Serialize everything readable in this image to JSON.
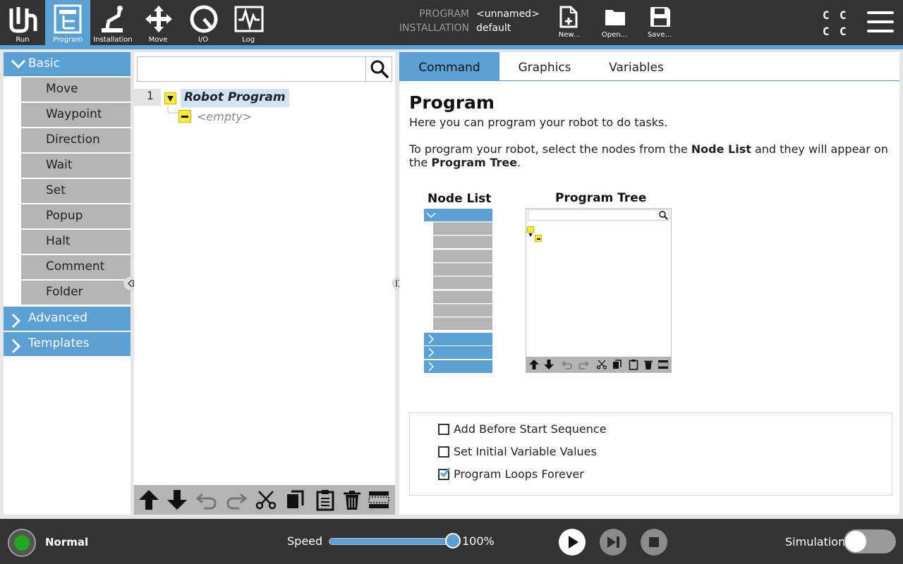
{
  "topbar": {
    "nav": [
      {
        "id": "run",
        "label": "Run",
        "icon": "ur-logo-icon"
      },
      {
        "id": "program",
        "label": "Program",
        "icon": "program-tree-icon",
        "active": true
      },
      {
        "id": "installation",
        "label": "Installation",
        "icon": "robot-arm-icon"
      },
      {
        "id": "move",
        "label": "Move",
        "icon": "move-arrows-icon"
      },
      {
        "id": "io",
        "label": "I/O",
        "icon": "io-gauge-icon"
      },
      {
        "id": "log",
        "label": "Log",
        "icon": "log-chart-icon"
      }
    ],
    "program_key": "PROGRAM",
    "program_value": "<unnamed>",
    "installation_key": "INSTALLATION",
    "installation_value": "default",
    "file_buttons": [
      {
        "label": "New...",
        "icon": "new-file-icon"
      },
      {
        "label": "Open...",
        "icon": "folder-icon"
      },
      {
        "label": "Save...",
        "icon": "save-icon"
      }
    ],
    "cc_letters": [
      "C",
      "C",
      "C",
      "C"
    ]
  },
  "left_panel": {
    "basic_label": "Basic",
    "basic_nodes": [
      "Move",
      "Waypoint",
      "Direction",
      "Wait",
      "Set",
      "Popup",
      "Halt",
      "Comment",
      "Folder"
    ],
    "advanced_label": "Advanced",
    "templates_label": "Templates"
  },
  "program_tree": {
    "search_placeholder": "",
    "line_number": "1",
    "root_label": "Robot Program",
    "empty_label": "<empty>"
  },
  "right_panel": {
    "tabs": [
      "Command",
      "Graphics",
      "Variables"
    ],
    "active_tab": "Command",
    "title": "Program",
    "intro": "Here you can program your robot to do tasks.",
    "instr_part1": "To program your robot, select the nodes from the ",
    "instr_bold1": "Node List",
    "instr_part2": " and they will appear on",
    "instr_part3": "the ",
    "instr_bold2": "Program Tree",
    "instr_part4": ".",
    "node_list_label": "Node List",
    "program_tree_label": "Program Tree",
    "options": [
      {
        "label": "Add Before Start Sequence",
        "checked": false
      },
      {
        "label": "Set Initial Variable Values",
        "checked": false
      },
      {
        "label": "Program Loops Forever",
        "checked": true
      }
    ]
  },
  "footer": {
    "status_label": "Normal",
    "status_color": "#1fa81f",
    "speed_label": "Speed",
    "speed_value": "100%",
    "speed_fraction": 1.0,
    "simulation_label": "Simulation",
    "simulation_on": false
  },
  "colors": {
    "accent": "#5aa0d5",
    "bar": "#333333",
    "node_grey": "#b4b4b4",
    "highlight": "#ffeb3b"
  }
}
